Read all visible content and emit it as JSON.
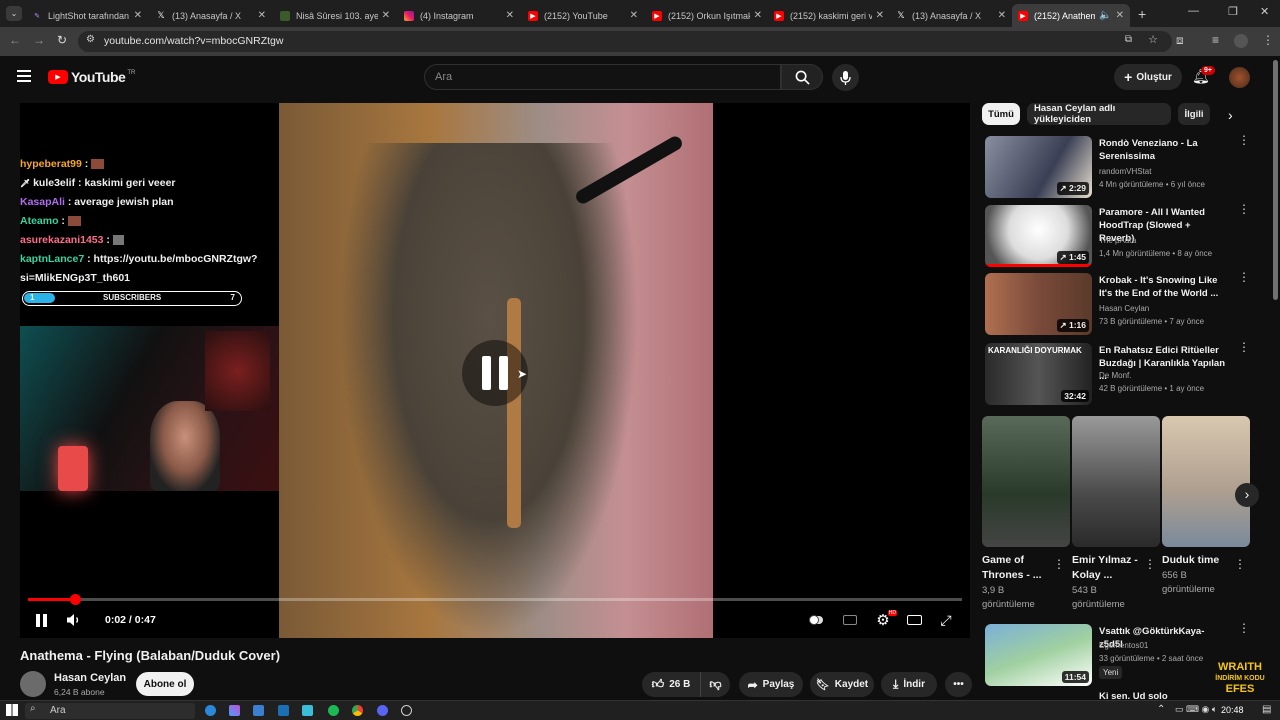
{
  "browser": {
    "tabs": [
      {
        "title": "LightShot tarafından",
        "active": false
      },
      {
        "title": "(13) Anasayfa / X",
        "active": false
      },
      {
        "title": "Nisâ Sûresi 103. ayeti",
        "active": false
      },
      {
        "title": "(4) Instagram",
        "active": false
      },
      {
        "title": "(2152) YouTube",
        "active": false
      },
      {
        "title": "(2152) Orkun Işıtmak",
        "active": false
      },
      {
        "title": "(2152) kaskimi geri ve",
        "active": false
      },
      {
        "title": "(13) Anasayfa / X",
        "active": false
      },
      {
        "title": "(2152) Anathema",
        "active": true
      }
    ],
    "url": "youtube.com/watch?v=mbocGNRZtgw"
  },
  "yt_header": {
    "logo_text": "YouTube",
    "logo_region": "TR",
    "search_placeholder": "Ara",
    "create_label": "Oluştur",
    "notif_count": "9+"
  },
  "player": {
    "chat": [
      {
        "user": "hypeberat99",
        "msg": "",
        "color": "#f5a623"
      },
      {
        "user": "kule3elif",
        "msg": "kaskimi geri veeer",
        "color": "#f1f1f1"
      },
      {
        "user": "KasapAli",
        "msg": "average jewish plan",
        "color": "#b26cf0"
      },
      {
        "user": "Ateamo",
        "msg": "",
        "color": "#38d39f"
      },
      {
        "user": "asurekazani1453",
        "msg": "",
        "color": "#ff6b8a"
      },
      {
        "user": "kaptnLance7",
        "msg": "https://youtu.be/mbocGNRZtgw?",
        "color": "#38d39f"
      },
      {
        "user": "",
        "msg": "si=MlikENGp3T_th601",
        "color": "#f1f1f1"
      }
    ],
    "sub_goal": {
      "label": "SUBSCRIBERS",
      "left": "1",
      "right": "7",
      "fraction": 0.14
    },
    "time": "0:02 / 0:47",
    "progress": 0.05
  },
  "video": {
    "title": "Anathema - Flying (Balaban/Duduk Cover)",
    "channel": "Hasan Ceylan",
    "subscribers": "6,24 B abone",
    "subscribe_label": "Abone ol",
    "likes": "26 B",
    "share_label": "Paylaş",
    "save_label": "Kaydet",
    "download_label": "İndir"
  },
  "sidebar": {
    "chips": [
      "Tümü",
      "Hasan Ceylan adlı yükleyiciden",
      "İlgili"
    ],
    "recs": [
      {
        "title": "Rondò Veneziano - La Serenissima",
        "channel": "randomVHStat",
        "meta": "4 Mn görüntüleme • 6 yıl önce",
        "duration": "2:29",
        "thumb": "#5a6a7a"
      },
      {
        "title": "Paramore - All I Wanted HoodTrap (Slowed + Reverb)",
        "channel": "The pAura",
        "meta": "1,4 Mn görüntüleme • 8 ay önce",
        "duration": "1:45",
        "thumb": "#d8d8d8"
      },
      {
        "title": "Krobak - It's Snowing Like It's the End of the World ...",
        "channel": "Hasan Ceylan",
        "meta": "73 B görüntüleme • 7 ay önce",
        "duration": "1:16",
        "thumb": "#8a4a3a"
      },
      {
        "title": "En Rahatsız Edici Ritüeller Buzdağı | Karanlıkla Yapılan ...",
        "channel": "De Monf.",
        "meta": "42 B görüntüleme • 1 ay önce",
        "duration": "32:42",
        "thumb": "#3a3a3a"
      }
    ],
    "thumb_text_4": "KARANLIĞI DOYURMAK",
    "shorts": [
      {
        "title1": "Game of",
        "title2": "Thrones - ...",
        "views1": "3,9 B",
        "views2": "görüntüleme",
        "thumb": "#4a5a4a"
      },
      {
        "title1": "Emir Yılmaz -",
        "title2": "Kolay ...",
        "views1": "543 B",
        "views2": "görüntüleme",
        "thumb": "#6a6a6a"
      },
      {
        "title1": "Duduk time",
        "title2": "",
        "views1": "656 B",
        "views2": "görüntüleme",
        "thumb": "#c8b8a8"
      }
    ],
    "rec5": {
      "title": "Vsattık @GöktürkKaya-z5d5l",
      "channel": "Egementos01",
      "meta": "33 görüntüleme • 2 saat önce",
      "badge": "Yeni",
      "duration": "11:54"
    },
    "rec6_title": "Ki sen. Ud solo",
    "ad": {
      "line1": "WRAITH",
      "line2": "İNDİRİM KODU",
      "line3": "EFES"
    }
  },
  "taskbar": {
    "search": "Ara",
    "time": "20:48"
  }
}
